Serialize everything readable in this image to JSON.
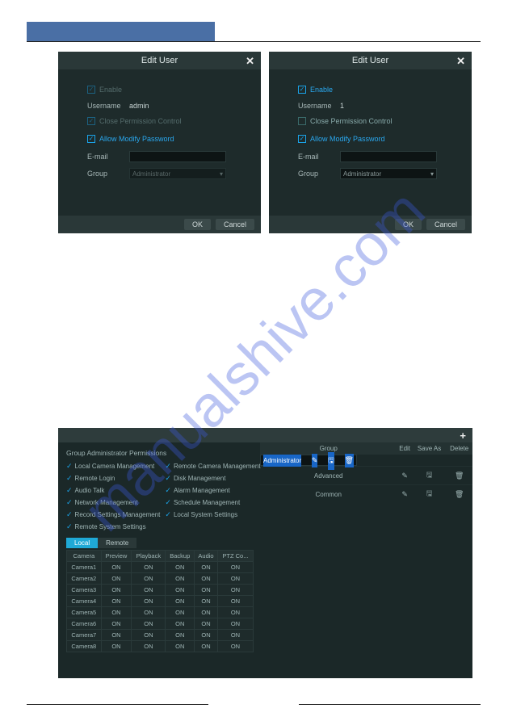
{
  "watermark": "manualshive.com",
  "dialog_title": "Edit User",
  "labels": {
    "enable": "Enable",
    "username": "Username",
    "close_perm": "Close Permission Control",
    "allow_modify": "Allow Modify Password",
    "email": "E-mail",
    "group": "Group",
    "ok": "OK",
    "cancel": "Cancel"
  },
  "dlg1": {
    "username_value": "admin",
    "group_value": "Administrator"
  },
  "dlg2": {
    "username_value": "1",
    "group_value": "Administrator"
  },
  "perm": {
    "title": "Group Administrator Permissions",
    "items_col1": [
      "Local Camera Management",
      "Remote Login",
      "Audio Talk",
      "Network Management",
      "Record Settings Management",
      "Remote System Settings"
    ],
    "items_col2": [
      "Remote Camera Management",
      "Disk Management",
      "Alarm Management",
      "Schedule Management",
      "Local System Settings"
    ],
    "tabs": {
      "local": "Local",
      "remote": "Remote"
    },
    "cam_headers": [
      "Camera",
      "Preview",
      "Playback",
      "Backup",
      "Audio",
      "PTZ Co..."
    ],
    "cam_rows": [
      [
        "Camera1",
        "ON",
        "ON",
        "ON",
        "ON",
        "ON"
      ],
      [
        "Camera2",
        "ON",
        "ON",
        "ON",
        "ON",
        "ON"
      ],
      [
        "Camera3",
        "ON",
        "ON",
        "ON",
        "ON",
        "ON"
      ],
      [
        "Camera4",
        "ON",
        "ON",
        "ON",
        "ON",
        "ON"
      ],
      [
        "Camera5",
        "ON",
        "ON",
        "ON",
        "ON",
        "ON"
      ],
      [
        "Camera6",
        "ON",
        "ON",
        "ON",
        "ON",
        "ON"
      ],
      [
        "Camera7",
        "ON",
        "ON",
        "ON",
        "ON",
        "ON"
      ],
      [
        "Camera8",
        "ON",
        "ON",
        "ON",
        "ON",
        "ON"
      ]
    ],
    "grp_headers": [
      "Group",
      "Edit",
      "Save As",
      "Delete"
    ],
    "grp_rows": [
      {
        "name": "Administrator",
        "edit": "✎",
        "save": "🖫",
        "del": "🗑"
      },
      {
        "name": "Advanced",
        "edit": "✎",
        "save": "🖫",
        "del": "🗑"
      },
      {
        "name": "Common",
        "edit": "✎",
        "save": "🖫",
        "del": "🗑"
      }
    ]
  }
}
